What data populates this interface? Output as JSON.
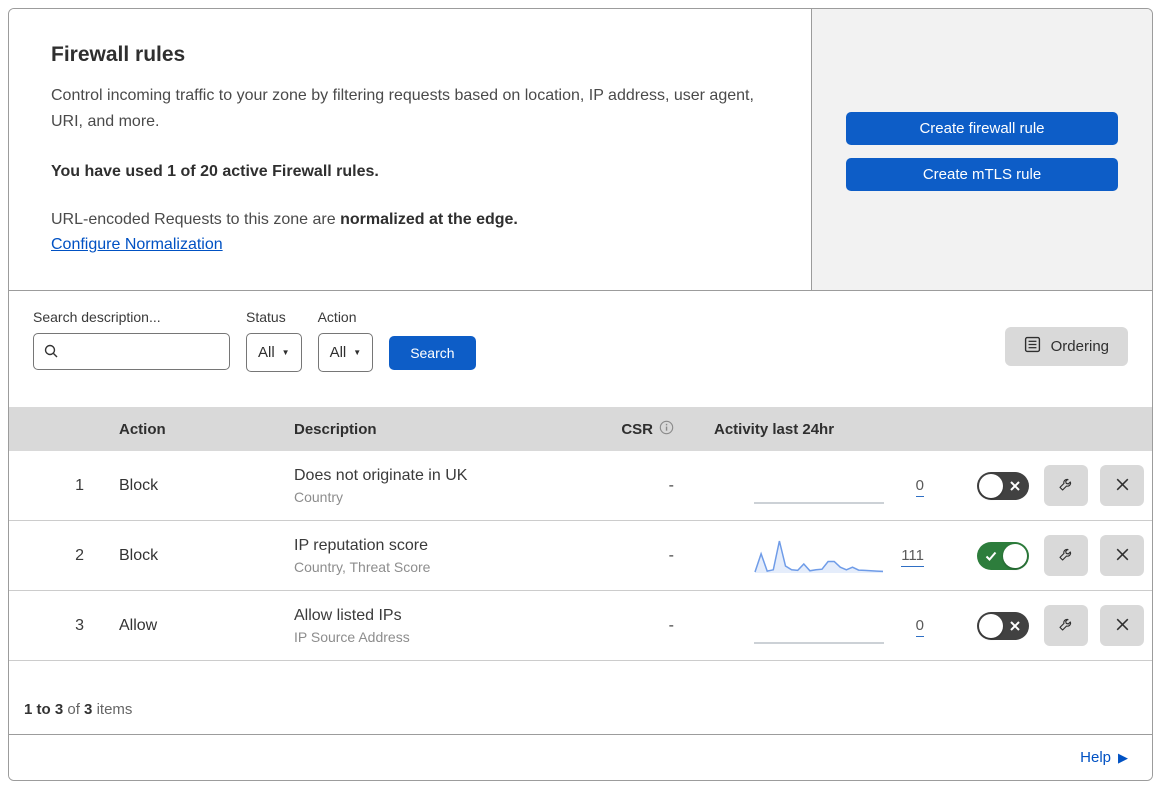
{
  "header": {
    "title": "Firewall rules",
    "description": "Control incoming traffic to your zone by filtering requests based on location, IP address, user agent, URI, and more.",
    "usage": "You have used 1 of 20 active Firewall rules.",
    "normalization_text": "URL-encoded Requests to this zone are ",
    "normalization_bold": "normalized at the edge.",
    "normalization_link": "Configure Normalization",
    "buttons": {
      "create_firewall": "Create firewall rule",
      "create_mtls": "Create mTLS rule"
    }
  },
  "filters": {
    "search_label": "Search description...",
    "search_value": "",
    "status_label": "Status",
    "status_value": "All",
    "action_label": "Action",
    "action_value": "All",
    "search_button": "Search",
    "ordering_button": "Ordering"
  },
  "table": {
    "columns": {
      "action": "Action",
      "description": "Description",
      "csr": "CSR",
      "activity": "Activity last 24hr"
    },
    "rows": [
      {
        "index": "1",
        "action": "Block",
        "description": "Does not originate in UK",
        "criteria": "Country",
        "csr": "-",
        "activity_count": "0",
        "enabled": false,
        "sparkline": []
      },
      {
        "index": "2",
        "action": "Block",
        "description": "IP reputation score",
        "criteria": "Country, Threat Score",
        "csr": "-",
        "activity_count": "111",
        "enabled": true,
        "sparkline": [
          3,
          60,
          6,
          10,
          100,
          22,
          10,
          8,
          28,
          7,
          10,
          12,
          36,
          36,
          18,
          10,
          18,
          9,
          8,
          7,
          6,
          5
        ]
      },
      {
        "index": "3",
        "action": "Allow",
        "description": "Allow listed IPs",
        "criteria": "IP Source Address",
        "csr": "-",
        "activity_count": "0",
        "enabled": false,
        "sparkline": []
      }
    ]
  },
  "footer": {
    "range": "1 to 3",
    "of": "of",
    "total": "3",
    "items": "items"
  },
  "help": {
    "label": "Help"
  },
  "icons": {
    "dropdown_caret": "▼",
    "help_arrow": "▶"
  },
  "colors": {
    "accent_blue": "#0d5dc7",
    "link_blue": "#0051c3",
    "toggle_on_green": "#2d7d3c",
    "toggle_off_gray": "#414141",
    "sparkline_blue": "#6f9ce8",
    "table_header_gray": "#d9d9d9",
    "panel_gray": "#f2f2f2"
  }
}
